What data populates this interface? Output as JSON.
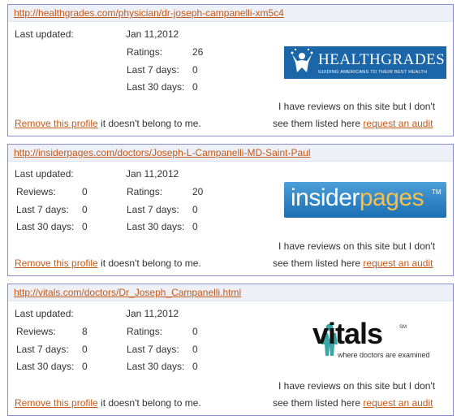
{
  "cards": [
    {
      "url": "http://healthgrades.com/physician/dr-joseph-campanelli-xm5c4",
      "last_updated_label": "Last updated:",
      "last_updated_value": "Jan 11,2012",
      "ratings_label": "Ratings:",
      "ratings_value": "26",
      "last7_label": "Last 7 days:",
      "last7_value": "0",
      "last30_label": "Last 30 days:",
      "last30_value": "0",
      "logo_text": "HEALTHGRADES",
      "logo_tagline": "GUIDING AMERICANS TO THEIR BEST HEALTH",
      "remove_link": "Remove this profile",
      "remove_suffix": " it doesn't belong to me.",
      "reviews_line1": "I have reviews on this site but I don't",
      "reviews_line2": "see them listed here ",
      "audit_link": "request an audit"
    },
    {
      "url": "http://insiderpages.com/doctors/Joseph-L-Campanelli-MD-Saint-Paul",
      "last_updated_label": "Last updated:",
      "last_updated_value": "Jan 11,2012",
      "reviews_label": "Reviews:",
      "reviews_value": "0",
      "last7_label": "Last 7 days:",
      "last7_value": "0",
      "last30_label": "Last 30 days:",
      "last30_value": "0",
      "ratings_label": "Ratings:",
      "ratings_value": "20",
      "r_last7_label": "Last 7 days:",
      "r_last7_value": "0",
      "r_last30_label": "Last 30 days:",
      "r_last30_value": "0",
      "logo_text_a": "insider",
      "logo_text_b": "pages",
      "logo_tm": "TM",
      "remove_link": "Remove this profile",
      "remove_suffix": " it doesn't belong to me.",
      "reviews_line1": "I have reviews on this site but I don't",
      "reviews_line2": "see them listed here ",
      "audit_link": "request an audit"
    },
    {
      "url": "http://vitals.com/doctors/Dr_Joseph_Campanelli.html",
      "last_updated_label": "Last updated:",
      "last_updated_value": "Jan 11,2012",
      "reviews_label": "Reviews:",
      "reviews_value": "8",
      "last7_label": "Last 7 days:",
      "last7_value": "0",
      "last30_label": "Last 30 days:",
      "last30_value": "0",
      "ratings_label": "Ratings:",
      "ratings_value": "0",
      "r_last7_label": "Last 7 days:",
      "r_last7_value": "0",
      "r_last30_label": "Last 30 days:",
      "r_last30_value": "0",
      "logo_text": "vitals",
      "logo_sm": "SM",
      "logo_tagline": "where doctors are examined",
      "remove_link": "Remove this profile",
      "remove_suffix": " it doesn't belong to me.",
      "reviews_line1": "I have reviews on this site but I don't",
      "reviews_line2": "see them listed here ",
      "audit_link": "request an audit"
    }
  ],
  "colors": {
    "link": "#c45a1a",
    "border": "#8c8fcf",
    "healthgrades_blue": "#1a66a8",
    "insider_yellow": "#f7c04a"
  },
  "icons": {
    "healthgrades": "star-person-icon",
    "vitals": "doctor-figure-icon"
  }
}
